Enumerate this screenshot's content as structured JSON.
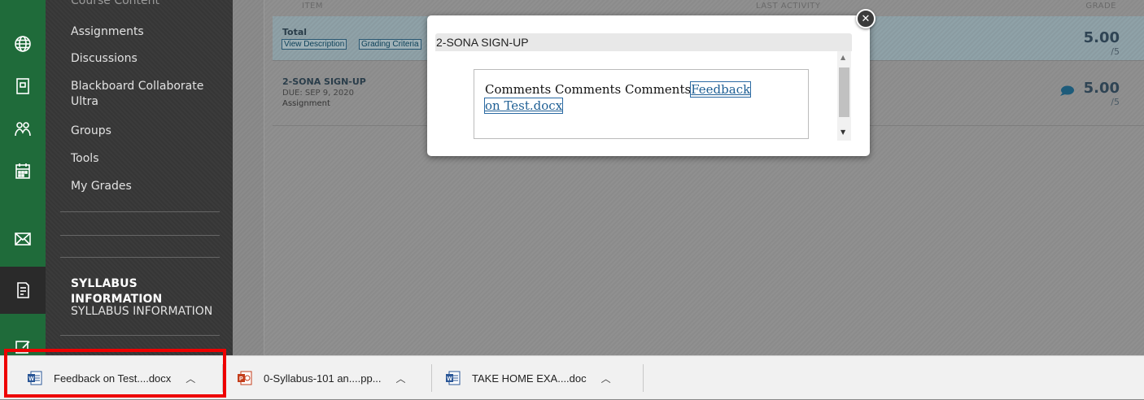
{
  "course_menu": {
    "cut_item": "Course Content",
    "items": [
      "Assignments",
      "Discussions",
      "Blackboard Collaborate Ultra",
      "Groups",
      "Tools",
      "My Grades"
    ],
    "section_heading": "SYLLABUS INFORMATION",
    "section_item": "SYLLABUS INFORMATION"
  },
  "rail_icons": [
    "globe-icon",
    "book-icon",
    "people-icon",
    "calendar-icon",
    "mail-icon",
    "syllabus-icon",
    "edit-icon"
  ],
  "grades": {
    "columns": {
      "item": "ITEM",
      "last_activity": "LAST ACTIVITY",
      "grade": "GRADE"
    },
    "rows": [
      {
        "title": "Total",
        "links": [
          "View Description",
          "Grading Criteria"
        ],
        "grade": "5.00",
        "out_of": "/5"
      },
      {
        "title": "2-SONA SIGN-UP",
        "due": "DUE: SEP 9, 2020",
        "type": "Assignment",
        "grade": "5.00",
        "out_of": "/5"
      }
    ]
  },
  "modal": {
    "title": "2-SONA SIGN-UP",
    "comment_text": "Comments Comments Comments",
    "attachment_link": "Feedback on Test.docx"
  },
  "downloads": [
    {
      "name": "Feedback on Test....docx",
      "icon": "word-icon",
      "highlighted": true
    },
    {
      "name": "0-Syllabus-101 an....pp...",
      "icon": "powerpoint-icon"
    },
    {
      "name": "TAKE HOME EXA....doc",
      "icon": "word-icon"
    }
  ],
  "colors": {
    "rail": "#1f6b3a",
    "menu": "#3a3a3a",
    "highlight": "#e00000",
    "link": "#1f5f94"
  }
}
